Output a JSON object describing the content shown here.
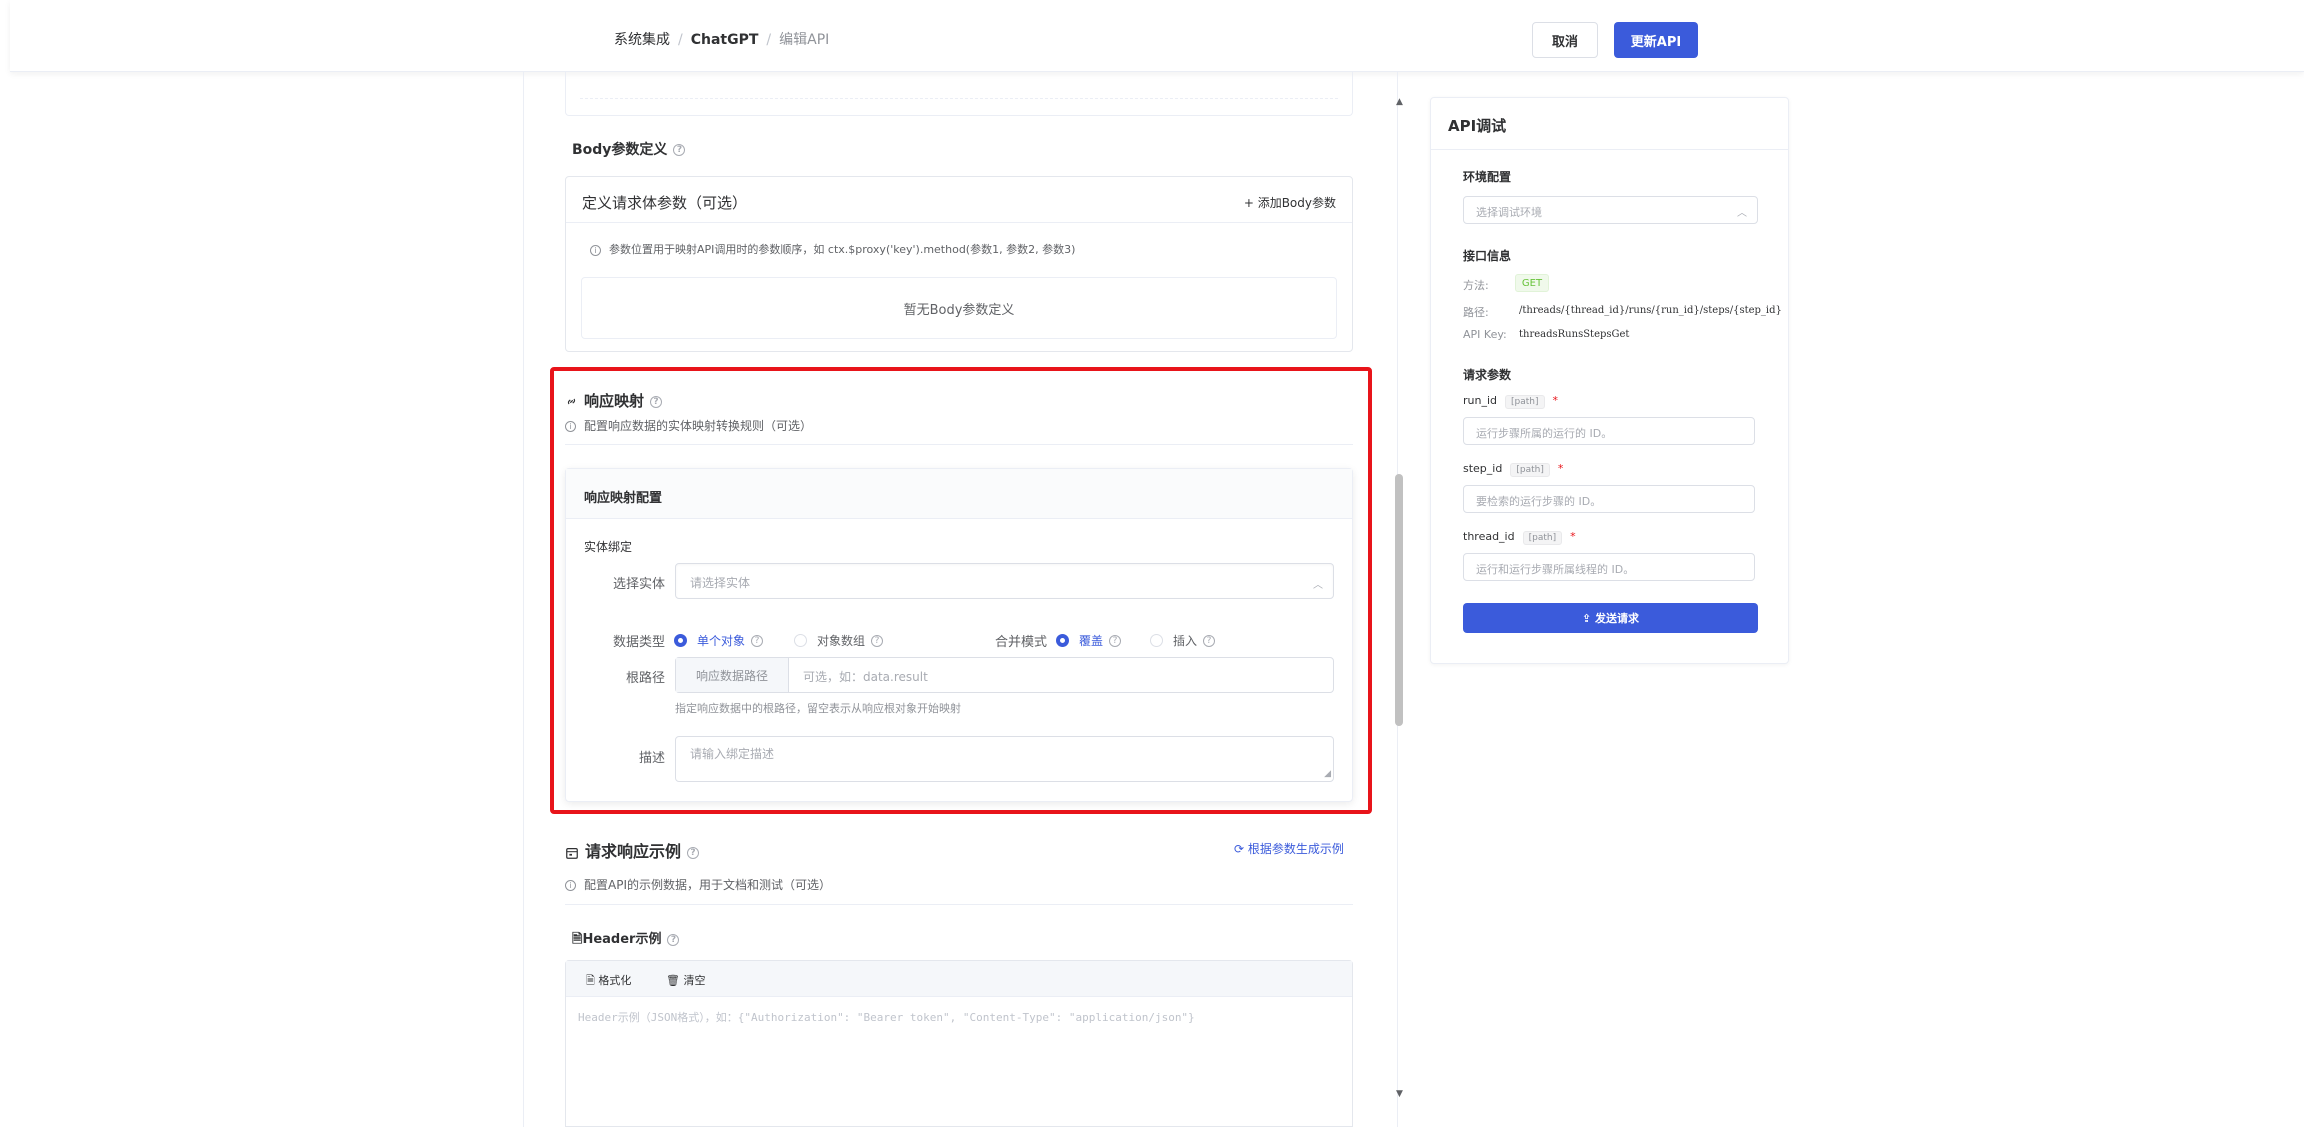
{
  "header": {
    "breadcrumb": [
      "系统集成",
      "ChatGPT",
      "编辑API"
    ],
    "cancel_label": "取消",
    "update_label": "更新API"
  },
  "body_params": {
    "section_title": "Body参数定义",
    "card_title": "定义请求体参数（可选）",
    "add_label": "+ 添加Body参数",
    "hint": "参数位置用于映射API调用时的参数顺序，如 ctx.$proxy('key').method(参数1, 参数2, 参数3)",
    "empty_text": "暂无Body参数定义"
  },
  "response_mapping": {
    "title": "响应映射",
    "hint": "配置响应数据的实体映射转换规则（可选）",
    "card_title": "响应映射配置",
    "entity_section": "实体绑定",
    "select_entity_label": "选择实体",
    "select_entity_placeholder": "请选择实体",
    "data_type_label": "数据类型",
    "data_type_options": [
      "单个对象",
      "对象数组"
    ],
    "merge_mode_label": "合并模式",
    "merge_mode_options": [
      "覆盖",
      "插入"
    ],
    "root_path_label": "根路径",
    "root_path_prefix": "响应数据路径",
    "root_path_placeholder": "可选，如：data.result",
    "root_path_help": "指定响应数据中的根路径，留空表示从响应根对象开始映射",
    "desc_label": "描述",
    "desc_placeholder": "请输入绑定描述"
  },
  "examples": {
    "title": "请求响应示例",
    "generate_label": "根据参数生成示例",
    "hint": "配置API的示例数据，用于文档和测试（可选）",
    "header_title": "Header示例",
    "format_label": "格式化",
    "clear_label": "清空",
    "header_placeholder": "Header示例（JSON格式），如：{\"Authorization\": \"Bearer token\", \"Content-Type\": \"application/json\"}"
  },
  "debug_panel": {
    "title": "API调试",
    "env_title": "环境配置",
    "env_placeholder": "选择调试环境",
    "info_title": "接口信息",
    "method_label": "方法:",
    "method_value": "GET",
    "path_label": "路径:",
    "path_value": "/threads/{thread_id}/runs/{run_id}/steps/{step_id}",
    "apikey_label": "API Key:",
    "apikey_value": "threadsRunsStepsGet",
    "params_title": "请求参数",
    "params": [
      {
        "name": "run_id",
        "tag": "[path]",
        "required": "*",
        "placeholder": "运行步骤所属的运行的 ID。"
      },
      {
        "name": "step_id",
        "tag": "[path]",
        "required": "*",
        "placeholder": "要检索的运行步骤的 ID。"
      },
      {
        "name": "thread_id",
        "tag": "[path]",
        "required": "*",
        "placeholder": "运行和运行步骤所属线程的 ID。"
      }
    ],
    "send_label": "发送请求"
  },
  "colors": {
    "primary": "#3b5bdb",
    "highlight": "#e8141a",
    "success": "#67c23a"
  },
  "scrollbar": {
    "position_fraction": 0.38
  }
}
